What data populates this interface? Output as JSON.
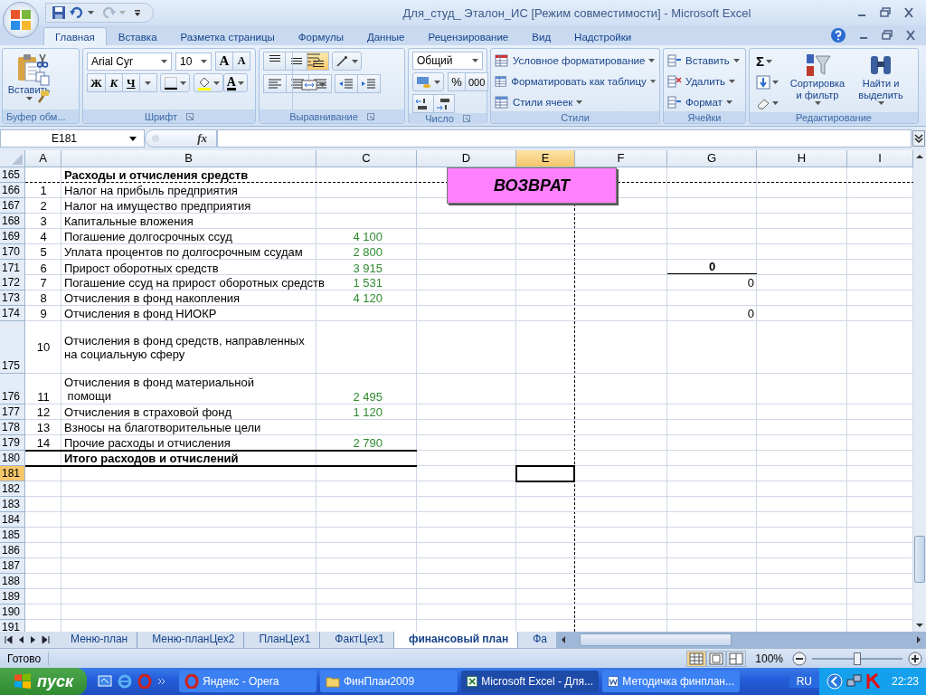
{
  "window": {
    "title": "Для_студ_ Эталон_ИС  [Режим совместимости] - Microsoft Excel"
  },
  "ribbon_tabs": [
    {
      "label": "Главная",
      "selected": true
    },
    {
      "label": "Вставка",
      "selected": false
    },
    {
      "label": "Разметка страницы",
      "selected": false
    },
    {
      "label": "Формулы",
      "selected": false
    },
    {
      "label": "Данные",
      "selected": false
    },
    {
      "label": "Рецензирование",
      "selected": false
    },
    {
      "label": "Вид",
      "selected": false
    },
    {
      "label": "Надстройки",
      "selected": false
    }
  ],
  "clipboard": {
    "label": "Буфер обм...",
    "paste": "Вставить"
  },
  "font": {
    "label": "Шрифт",
    "name": "Arial Cyr",
    "size": "10",
    "grow": "A",
    "shrink": "A",
    "bold": "Ж",
    "italic": "К",
    "underline": "Ч",
    "color_label": "A"
  },
  "alignment": {
    "label": "Выравнивание",
    "vertical": [
      {
        "selected": false
      },
      {
        "selected": false
      },
      {
        "selected": true
      }
    ]
  },
  "number": {
    "label": "Число",
    "format": "Общий",
    "percent": "%",
    "thousands": "000"
  },
  "styles": {
    "label": "Стили",
    "items": [
      "Условное форматирование",
      "Форматировать как таблицу",
      "Стили ячеек"
    ]
  },
  "cells": {
    "label": "Ячейки",
    "items": [
      "Вставить",
      "Удалить",
      "Формат"
    ]
  },
  "editing": {
    "label": "Редактирование",
    "sum": "Σ",
    "sort": "Сортировка\nи фильтр",
    "find": "Найти и\nвыделить"
  },
  "formula_bar": {
    "name_box": "E181",
    "function_label": "fx"
  },
  "sheet": {
    "columns": [
      {
        "label": "A",
        "selected": false
      },
      {
        "label": "B",
        "selected": false
      },
      {
        "label": "C",
        "selected": false
      },
      {
        "label": "D",
        "selected": false
      },
      {
        "label": "E",
        "selected": true
      },
      {
        "label": "F",
        "selected": false
      },
      {
        "label": "G",
        "selected": false
      },
      {
        "label": "H",
        "selected": false
      },
      {
        "label": "I",
        "selected": false
      }
    ],
    "rows": [
      {
        "number": "165",
        "kind": "header",
        "selected": false,
        "b": "Расходы и отчисления средств"
      },
      {
        "number": "166",
        "kind": "item",
        "selected": false,
        "a": "1",
        "b": "Налог на прибыль предприятия"
      },
      {
        "number": "167",
        "kind": "item",
        "selected": false,
        "a": "2",
        "b": "Налог на имущество предприятия"
      },
      {
        "number": "168",
        "kind": "item",
        "selected": false,
        "a": "3",
        "b": "Капитальные вложения"
      },
      {
        "number": "169",
        "kind": "item",
        "selected": false,
        "a": "4",
        "b": "Погашение долгосрочных ссуд",
        "c": "4 100"
      },
      {
        "number": "170",
        "kind": "item",
        "selected": false,
        "a": "5",
        "b": "Уплата процентов по долгосрочным ссудам",
        "c": "2 800"
      },
      {
        "number": "171",
        "kind": "item",
        "selected": false,
        "a": "6",
        "b": "Прирост оборотных средств",
        "c": "3 915",
        "g": {
          "text": "0",
          "kind": "subtotal"
        }
      },
      {
        "number": "172",
        "kind": "item",
        "selected": false,
        "a": "7",
        "b": "Погашение ссуд на прирост оборотных средств",
        "c": "1 531",
        "g": {
          "text": "0",
          "kind": "plain"
        }
      },
      {
        "number": "173",
        "kind": "item",
        "selected": false,
        "a": "8",
        "b": "Отчисления в фонд накопления",
        "c": "4 120"
      },
      {
        "number": "174",
        "kind": "item",
        "selected": false,
        "a": "9",
        "b": "Отчисления в фонд НИОКР",
        "g": {
          "text": "0",
          "kind": "plain"
        }
      },
      {
        "number": "175",
        "kind": "tall",
        "selected": false,
        "a": "10",
        "b": "Отчисления в фонд средств, направленных\nна социальную сферу"
      },
      {
        "number": "176",
        "kind": "double",
        "selected": false,
        "a": "11",
        "b": "Отчисления в фонд материальной\n помощи",
        "c": "2 495"
      },
      {
        "number": "177",
        "kind": "item",
        "selected": false,
        "a": "12",
        "b": "Отчисления в страховой фонд",
        "c": "1 120"
      },
      {
        "number": "178",
        "kind": "item",
        "selected": false,
        "a": "13",
        "b": "Взносы на благотворительные цели"
      },
      {
        "number": "179",
        "kind": "item",
        "selected": false,
        "a": "14",
        "b": "Прочие расходы и отчисления",
        "c": "2 790"
      },
      {
        "number": "180",
        "kind": "total",
        "selected": false,
        "b": "Итого расходов и отчислений"
      },
      {
        "number": "181",
        "kind": "empty",
        "selected": true
      },
      {
        "number": "182",
        "kind": "empty",
        "selected": false
      },
      {
        "number": "183",
        "kind": "empty",
        "selected": false
      },
      {
        "number": "184",
        "kind": "empty",
        "selected": false
      },
      {
        "number": "185",
        "kind": "empty",
        "selected": false
      },
      {
        "number": "186",
        "kind": "empty",
        "selected": false
      },
      {
        "number": "187",
        "kind": "empty",
        "selected": false
      },
      {
        "number": "188",
        "kind": "empty",
        "selected": false
      },
      {
        "number": "189",
        "kind": "empty",
        "selected": false
      },
      {
        "number": "190",
        "kind": "empty",
        "selected": false
      },
      {
        "number": "191",
        "kind": "empty",
        "selected": false
      }
    ]
  },
  "shape_button": {
    "label": "ВОЗВРАТ"
  },
  "sheet_tabs": [
    {
      "label": "Меню-план",
      "selected": false
    },
    {
      "label": "Меню-планЦех2",
      "selected": false
    },
    {
      "label": "ПланЦех1",
      "selected": false
    },
    {
      "label": "ФактЦех1",
      "selected": false
    },
    {
      "label": "финансовый план",
      "selected": true
    },
    {
      "label": "Фа",
      "selected": false
    }
  ],
  "status_bar": {
    "text": "Готово",
    "views": [
      {
        "selected": true
      },
      {
        "selected": false
      },
      {
        "selected": false
      }
    ],
    "zoom": "100%",
    "zoom_slider": {
      "level": 0.5
    }
  },
  "taskbar": {
    "start": "пуск",
    "tasks": [
      {
        "label": "Яндекс - Opera",
        "kind": "opera",
        "selected": false
      },
      {
        "label": "ФинПлан2009",
        "kind": "folder",
        "selected": false
      },
      {
        "label": "Microsoft Excel - Для...",
        "kind": "excel",
        "selected": true
      },
      {
        "label": "Методичка финплан...",
        "kind": "word",
        "selected": false
      }
    ],
    "language": "RU",
    "clock": "22:23"
  }
}
